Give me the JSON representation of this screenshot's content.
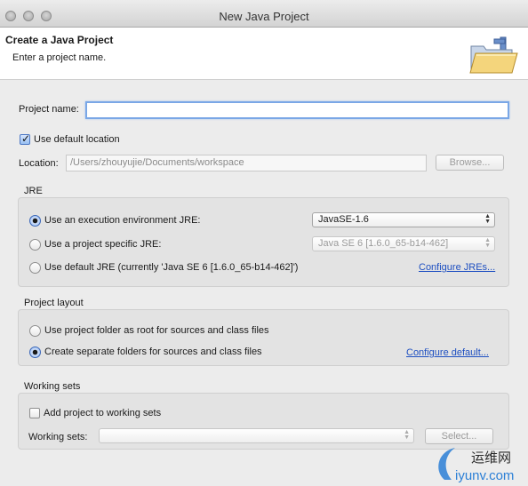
{
  "window": {
    "title": "New Java Project"
  },
  "header": {
    "title": "Create a Java Project",
    "description": "Enter a project name."
  },
  "project": {
    "name_label": "Project name:",
    "name_value": "",
    "use_default_location_label": "Use default location",
    "use_default_location_checked": true,
    "location_label": "Location:",
    "location_value": "/Users/zhouyujie/Documents/workspace",
    "browse_label": "Browse..."
  },
  "jre": {
    "title": "JRE",
    "options": [
      {
        "label": "Use an execution environment JRE:",
        "selected": true
      },
      {
        "label": "Use a project specific JRE:",
        "selected": false
      },
      {
        "label": "Use default JRE (currently 'Java SE 6 [1.6.0_65-b14-462]')",
        "selected": false
      }
    ],
    "execution_env_value": "JavaSE-1.6",
    "project_specific_value": "Java SE 6 [1.6.0_65-b14-462]",
    "configure_link": "Configure JREs..."
  },
  "layout": {
    "title": "Project layout",
    "options": [
      {
        "label": "Use project folder as root for sources and class files",
        "selected": false
      },
      {
        "label": "Create separate folders for sources and class files",
        "selected": true
      }
    ],
    "configure_link": "Configure default..."
  },
  "working_sets": {
    "title": "Working sets",
    "add_label": "Add project to working sets",
    "add_checked": false,
    "sets_label": "Working sets:",
    "sets_value": "",
    "select_label": "Select..."
  },
  "watermark": {
    "text_cn": "运维网",
    "text_en": "iyunv.com"
  },
  "colors": {
    "link": "#1e4fc1",
    "focus": "#7aa7e6",
    "radio_selected": "#8eb5ee"
  },
  "icons": [
    "folder-icon",
    "check-icon",
    "select-arrows-icon"
  ]
}
